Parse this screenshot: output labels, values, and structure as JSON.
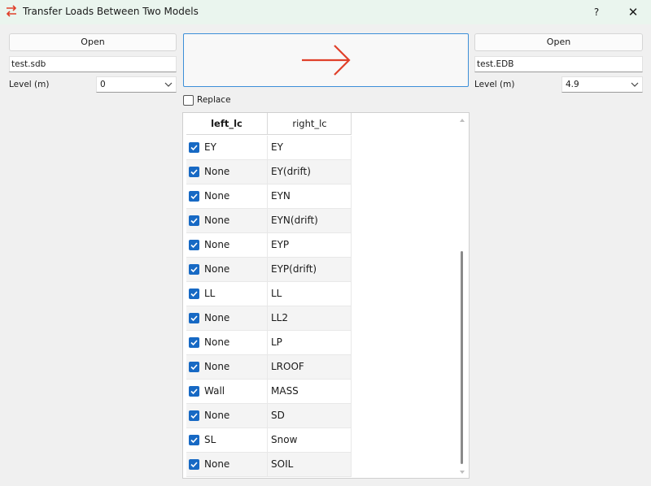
{
  "window": {
    "title": "Transfer Loads Between Two Models",
    "help_label": "?",
    "close_label": "✕",
    "icon": "transfer-arrows-icon"
  },
  "left_panel": {
    "open_label": "Open",
    "file_value": "test.sdb",
    "level_label": "Level (m)",
    "level_value": "0"
  },
  "right_panel": {
    "open_label": "Open",
    "file_value": "test.EDB",
    "level_label": "Level (m)",
    "level_value": "4.9"
  },
  "replace": {
    "label": "Replace",
    "checked": false
  },
  "table": {
    "columns": [
      "left_lc",
      "right_lc"
    ],
    "rows": [
      {
        "left": "EY",
        "right": "EY",
        "checked": true
      },
      {
        "left": "None",
        "right": "EY(drift)",
        "checked": true
      },
      {
        "left": "None",
        "right": "EYN",
        "checked": true
      },
      {
        "left": "None",
        "right": "EYN(drift)",
        "checked": true
      },
      {
        "left": "None",
        "right": "EYP",
        "checked": true
      },
      {
        "left": "None",
        "right": "EYP(drift)",
        "checked": true
      },
      {
        "left": "LL",
        "right": "LL",
        "checked": true
      },
      {
        "left": "None",
        "right": "LL2",
        "checked": true
      },
      {
        "left": "None",
        "right": "LP",
        "checked": true
      },
      {
        "left": "None",
        "right": "LROOF",
        "checked": true
      },
      {
        "left": "Wall",
        "right": "MASS",
        "checked": true
      },
      {
        "left": "None",
        "right": "SD",
        "checked": true
      },
      {
        "left": "SL",
        "right": "Snow",
        "checked": true
      },
      {
        "left": "None",
        "right": "SOIL",
        "checked": true
      }
    ]
  },
  "colors": {
    "titlebar_bg": "#eaf5ee",
    "arrow": "#e0402a",
    "checkbox": "#1769c4",
    "focus_border": "#3c8fd8"
  }
}
